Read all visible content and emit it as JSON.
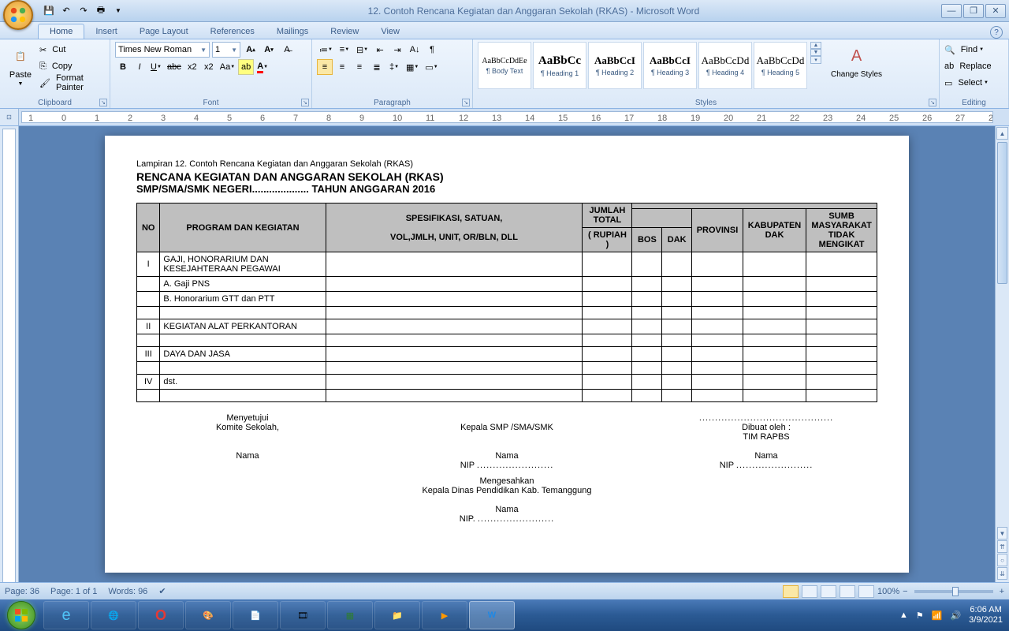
{
  "window": {
    "title": "12. Contoh Rencana Kegiatan dan Anggaran Sekolah (RKAS) - Microsoft Word"
  },
  "tabs": [
    "Home",
    "Insert",
    "Page Layout",
    "References",
    "Mailings",
    "Review",
    "View"
  ],
  "clipboard": {
    "paste": "Paste",
    "cut": "Cut",
    "copy": "Copy",
    "fmt": "Format Painter",
    "label": "Clipboard"
  },
  "font": {
    "name": "Times New Roman",
    "size": "1",
    "label": "Font"
  },
  "paragraph": {
    "label": "Paragraph"
  },
  "styles": {
    "label": "Styles",
    "items": [
      {
        "preview": "AaBbCcDdEe",
        "name": "¶ Body Text"
      },
      {
        "preview": "AaBbCc",
        "name": "¶ Heading 1"
      },
      {
        "preview": "AaBbCcI",
        "name": "¶ Heading 2"
      },
      {
        "preview": "AaBbCcI",
        "name": "¶ Heading 3"
      },
      {
        "preview": "AaBbCcDd",
        "name": "¶ Heading 4"
      },
      {
        "preview": "AaBbCcDd",
        "name": "¶ Heading 5"
      }
    ],
    "change": "Change Styles"
  },
  "editing": {
    "find": "Find",
    "replace": "Replace",
    "select": "Select",
    "label": "Editing"
  },
  "doc": {
    "lampiran": "Lampiran 12. Contoh Rencana Kegiatan dan Anggaran Sekolah (RKAS)",
    "title": "RENCANA KEGIATAN DAN ANGGARAN SEKOLAH (RKAS)",
    "sub": "SMP/SMA/SMK NEGERI.................... TAHUN ANGGARAN 2016",
    "headers": {
      "no": "NO",
      "prog": "PROGRAM DAN KEGIATAN",
      "spes1": "SPESIFIKASI, SATUAN,",
      "spes2": "VOL,JMLH, UNIT, OR/BLN, DLL",
      "jumlah": "JUMLAH TOTAL",
      "rupiah": "( RUPIAH )",
      "bos": "BOS",
      "dak": "DAK",
      "prov": "PROVINSI",
      "kab": "KABUPATEN DAK",
      "sumb": "SUMB MASYARAKAT TIDAK MENGIKAT"
    },
    "rows": [
      {
        "no": "I",
        "prog": "GAJI, HONORARIUM DAN KESEJAHTERAAN PEGAWAI"
      },
      {
        "no": "",
        "prog": "A. Gaji PNS"
      },
      {
        "no": "",
        "prog": "B. Honorarium GTT dan PTT"
      },
      {
        "no": "",
        "prog": ""
      },
      {
        "no": "II",
        "prog": "KEGIATAN ALAT PERKANTORAN"
      },
      {
        "no": "",
        "prog": ""
      },
      {
        "no": "III",
        "prog": "DAYA DAN JASA"
      },
      {
        "no": "",
        "prog": ""
      },
      {
        "no": "IV",
        "prog": "dst."
      },
      {
        "no": "",
        "prog": ""
      }
    ],
    "sig": {
      "menyetujui": "Menyetujui",
      "komite": "Komite Sekolah,",
      "kepala": "Kepala SMP  /SMA/SMK",
      "dibuat": "Dibuat oleh :",
      "tim": "TIM RAPBS",
      "nama": "Nama",
      "nip": "NIP",
      "mengesahkan": "Mengesahkan",
      "dinas": "Kepala Dinas Pendidikan Kab. Temanggung"
    }
  },
  "status": {
    "page": "Page: 36",
    "pageof": "Page: 1 of 1",
    "words": "Words: 96",
    "zoom": "100%"
  },
  "tray": {
    "time": "6:06 AM",
    "date": "3/9/2021"
  }
}
